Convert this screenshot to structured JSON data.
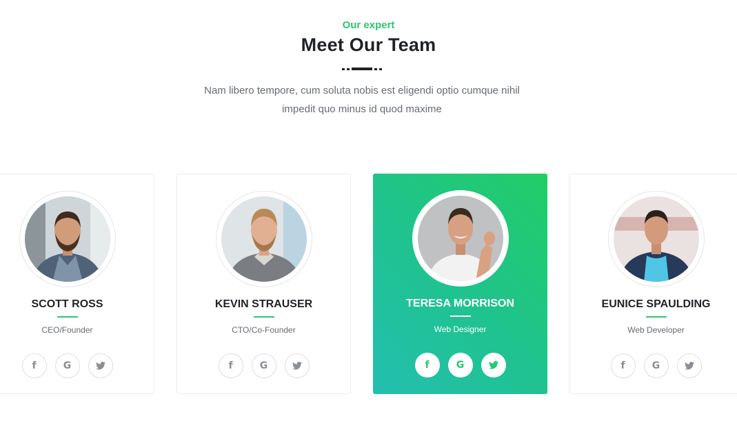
{
  "section": {
    "eyebrow": "Our expert",
    "title": "Meet Our Team",
    "subtitle": "Nam libero tempore, cum soluta nobis est eligendi optio cumque nihil impedit quo minus id quod maxime"
  },
  "social_icons": {
    "facebook": "f",
    "google": "G",
    "twitter": "twitter-bird"
  },
  "colors": {
    "accent": "#2ec56f",
    "active_gradient_start": "#22cd66",
    "active_gradient_end": "#23bfb0"
  },
  "team": [
    {
      "name": "SCOTT ROSS",
      "role": "CEO/Founder",
      "active": false
    },
    {
      "name": "KEVIN STRAUSER",
      "role": "CTO/Co-Founder",
      "active": false
    },
    {
      "name": "TERESA MORRISON",
      "role": "Web Designer",
      "active": true
    },
    {
      "name": "EUNICE SPAULDING",
      "role": "Web Developer",
      "active": false
    }
  ]
}
